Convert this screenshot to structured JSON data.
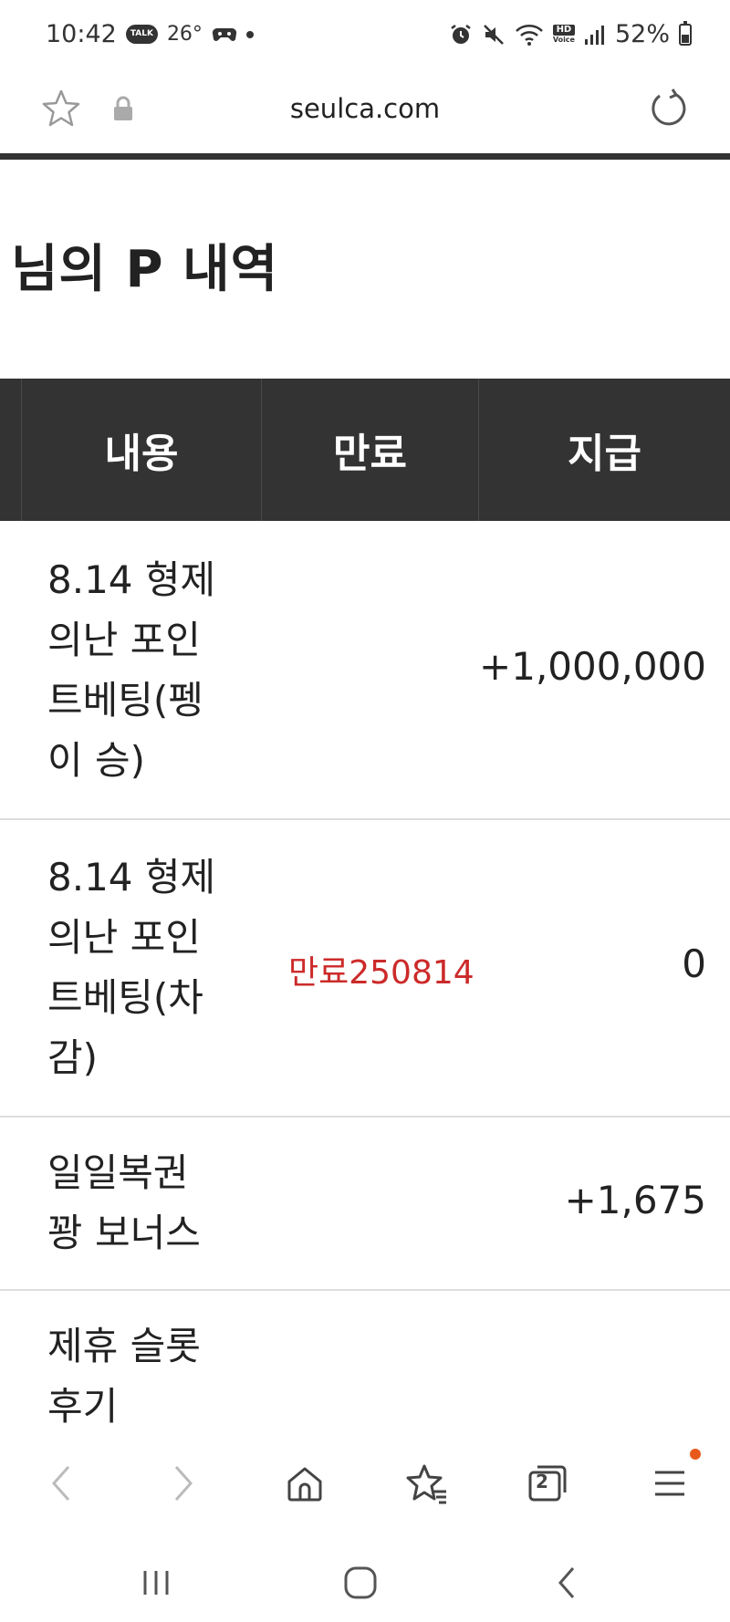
{
  "status_bar": {
    "time": "10:42",
    "kakao_badge": "TALK",
    "temperature": "26°",
    "hd_label_top": "HD",
    "hd_label_bottom": "Voice",
    "battery": "52%"
  },
  "browser": {
    "url": "seulca.com"
  },
  "page": {
    "title": "님의 P 내역"
  },
  "table": {
    "headers": {
      "content": "내용",
      "expire": "만료",
      "pay": "지급"
    },
    "rows": [
      {
        "content": "8.14 형제의난 포인트베팅(펭이 승)",
        "expire": "",
        "amount": "+1,000,000"
      },
      {
        "content": "8.14 형제의난 포인트베팅(차감)",
        "expire": "만료250814",
        "amount": "0"
      },
      {
        "content": "일일복권 꽝 보너스",
        "expire": "",
        "amount": "+1,675"
      },
      {
        "content": "제휴 슬롯 후기",
        "expire": "",
        "amount": ""
      }
    ]
  },
  "bottom_nav": {
    "tabs_count": "2"
  },
  "icons": {
    "favorite": "star-icon",
    "secure": "lock-icon",
    "refresh": "reload-icon",
    "back": "chevron-left-icon",
    "forward": "chevron-right-icon",
    "home": "home-icon",
    "bookmarks": "bookmark-star-icon",
    "tabs": "tabs-icon",
    "menu": "menu-icon"
  },
  "colors": {
    "header_bg": "#333333",
    "expire_text": "#cc2a2a",
    "notification_dot": "#e85a1b"
  }
}
